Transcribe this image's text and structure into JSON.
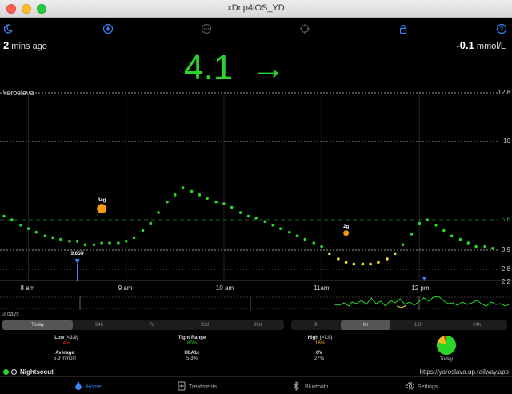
{
  "window": {
    "title": "xDrip4iOS_YD"
  },
  "header": {
    "time_ago_num": "2",
    "time_ago_text": " mins ago",
    "delta_num": "-0.1",
    "delta_unit": " mmol/L",
    "glucose": "4.1",
    "trend_arrow": "→",
    "owner": "Yaroslava"
  },
  "top_icons": [
    "moon-icon",
    "drop-icon",
    "dots-icon",
    "crosshair-icon",
    "lock-icon",
    "help-icon"
  ],
  "chart_data": {
    "type": "scatter",
    "y_axis_ticks": [
      "12,8",
      "10",
      "5,6",
      "3,9",
      "2,8",
      "2,2"
    ],
    "x_axis_ticks": [
      "8 am",
      "9 am",
      "10 am",
      "11am",
      "12 pm"
    ],
    "ylim": [
      2.2,
      12.8
    ],
    "xlim": [
      7.75,
      12.8
    ],
    "series": [
      {
        "values": [
          [
            7.75,
            5.8
          ],
          [
            7.83,
            5.6
          ],
          [
            7.92,
            5.3
          ],
          [
            8.0,
            5.1
          ],
          [
            8.08,
            4.9
          ],
          [
            8.17,
            4.7
          ],
          [
            8.25,
            4.6
          ],
          [
            8.33,
            4.5
          ],
          [
            8.42,
            4.4
          ],
          [
            8.5,
            4.4
          ],
          [
            8.58,
            4.2
          ],
          [
            8.67,
            4.2
          ],
          [
            8.75,
            4.3
          ],
          [
            8.83,
            4.3
          ],
          [
            8.92,
            4.3
          ],
          [
            9.0,
            4.4
          ],
          [
            9.08,
            4.6
          ],
          [
            9.17,
            5.0
          ],
          [
            9.25,
            5.4
          ],
          [
            9.33,
            6.0
          ],
          [
            9.42,
            6.6
          ],
          [
            9.5,
            7.0
          ],
          [
            9.58,
            7.4
          ],
          [
            9.67,
            7.2
          ],
          [
            9.75,
            7.0
          ],
          [
            9.83,
            6.8
          ],
          [
            9.92,
            6.6
          ],
          [
            10.0,
            6.5
          ],
          [
            10.08,
            6.3
          ],
          [
            10.17,
            6.0
          ],
          [
            10.25,
            5.8
          ],
          [
            10.33,
            5.7
          ],
          [
            10.42,
            5.5
          ],
          [
            10.5,
            5.3
          ],
          [
            10.58,
            5.1
          ],
          [
            10.67,
            4.9
          ],
          [
            10.75,
            4.7
          ],
          [
            10.83,
            4.5
          ],
          [
            10.92,
            4.3
          ],
          [
            11.0,
            4.1
          ],
          [
            11.08,
            3.7
          ],
          [
            11.17,
            3.4
          ],
          [
            11.25,
            3.2
          ],
          [
            11.33,
            3.1
          ],
          [
            11.42,
            3.1
          ],
          [
            11.5,
            3.1
          ],
          [
            11.58,
            3.2
          ],
          [
            11.67,
            3.4
          ],
          [
            11.75,
            3.7
          ],
          [
            11.83,
            4.2
          ],
          [
            11.92,
            4.8
          ],
          [
            12.0,
            5.4
          ],
          [
            12.08,
            5.6
          ],
          [
            12.17,
            5.3
          ],
          [
            12.25,
            5.0
          ],
          [
            12.33,
            4.7
          ],
          [
            12.42,
            4.5
          ],
          [
            12.5,
            4.3
          ],
          [
            12.58,
            4.1
          ],
          [
            12.67,
            4.1
          ],
          [
            12.75,
            4.0
          ]
        ]
      }
    ],
    "treatments": [
      {
        "type": "carbs",
        "label": "34g",
        "x": 8.75,
        "y": 6.0
      },
      {
        "type": "carbs",
        "label": "2g",
        "x": 11.25,
        "y": 5.3
      },
      {
        "type": "insulin",
        "label": "3,05U",
        "x": 8.5
      }
    ]
  },
  "mini_chart": {
    "label": "3 days"
  },
  "segments_left": {
    "items": [
      "Today",
      "24h",
      "7d",
      "30d",
      "90d"
    ],
    "selected": 0
  },
  "segments_right": {
    "items": [
      "3h",
      "6h",
      "12h",
      "24h"
    ],
    "selected": 1
  },
  "stats": {
    "low_label": "Low",
    "low_range": "(<3.9)",
    "low_value": "4%",
    "tight_label": "Tight Range",
    "tight_value": "80%",
    "high_label": "High",
    "high_range": "(>7.8)",
    "high_value": "16%",
    "average_label": "Average",
    "average_value": "5.9 mmol/l",
    "hba1c_label": "HbA1c",
    "hba1c_value": "5.3%",
    "cv_label": "CV",
    "cv_value": "27%",
    "pie_label": "Today",
    "pie": [
      0.8,
      0.16,
      0.04
    ],
    "colors": {
      "low": "#e02020",
      "in_range": "#2bd62b",
      "high": "#e8c020"
    }
  },
  "footer": {
    "nightscout": "Nightscout",
    "url": "https://yaroslava.up.railway.app"
  },
  "tabs": [
    "Home",
    "Treatments",
    "Bluetooth",
    "Settings"
  ],
  "colors": {
    "accent": "#3b82f6",
    "glucose_green": "#2bd62b",
    "low_yellow": "#e8e020"
  }
}
